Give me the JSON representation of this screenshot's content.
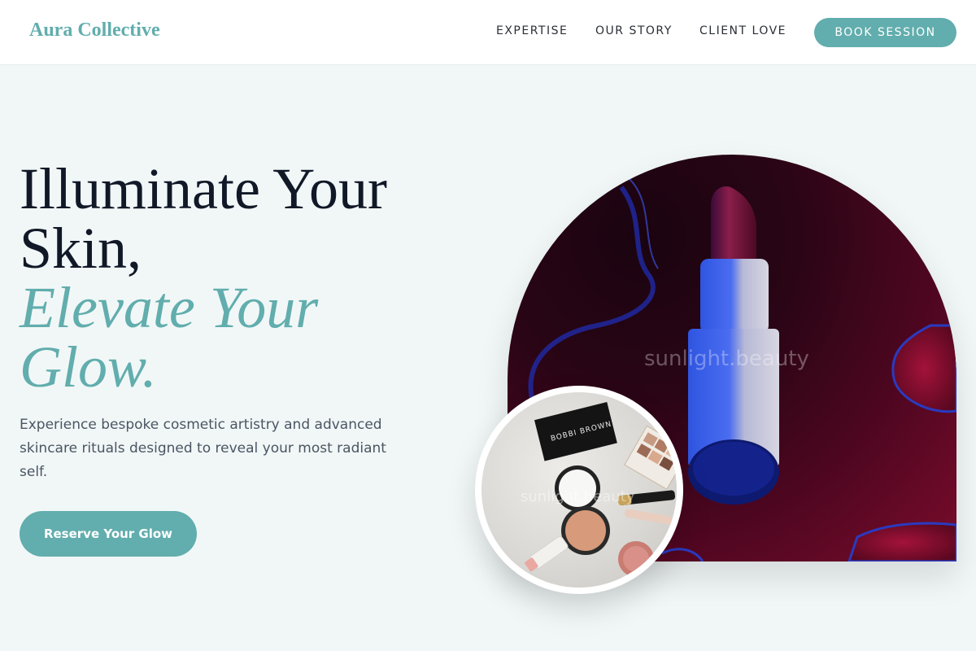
{
  "header": {
    "brand": "Aura Collective",
    "nav": [
      {
        "label": "EXPERTISE"
      },
      {
        "label": "OUR STORY"
      },
      {
        "label": "CLIENT LOVE"
      }
    ],
    "book_label": "BOOK SESSION"
  },
  "hero": {
    "title_lines": [
      "Illuminate Your",
      "Skin,"
    ],
    "accent_lines": [
      "Elevate Your",
      "Glow."
    ],
    "description": "Experience bespoke cosmetic artistry and advanced skincare rituals designed to reveal your most radiant self.",
    "cta_label": "Reserve Your Glow"
  },
  "images": {
    "arch_watermark": "sunlight.beauty",
    "circle_watermark": "sunlight.beauty",
    "compact_brand": "BOBBI BROWN"
  },
  "colors": {
    "accent": "#62adad",
    "heading": "#111827",
    "body_text": "#4b5563",
    "background": "#f1f7f7"
  }
}
